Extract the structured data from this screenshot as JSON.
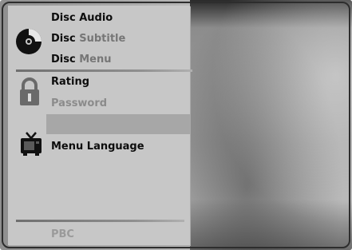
{
  "menu": {
    "groups": [
      {
        "icon": "disc-icon",
        "items": [
          {
            "label": "Disc Audio",
            "enabled": true
          },
          {
            "label_part1": "Disc",
            "label_part2": "Subtitle",
            "enabled": true
          },
          {
            "label_part1": "Disc",
            "label_part2": "Menu",
            "enabled": true
          }
        ]
      },
      {
        "icon": "padlock-icon",
        "items": [
          {
            "label": "Rating",
            "enabled": true
          },
          {
            "label": "Password",
            "enabled": false
          }
        ]
      },
      {
        "icon": "tv-icon",
        "items": [
          {
            "label": "Menu Language",
            "enabled": true
          }
        ]
      },
      {
        "icon": "",
        "items": [
          {
            "label": "PBC",
            "enabled": false
          }
        ]
      }
    ]
  },
  "colors": {
    "panel": "#c7c7c7",
    "text": "#0d0d0d",
    "dim_text": "#8b8b8b"
  }
}
